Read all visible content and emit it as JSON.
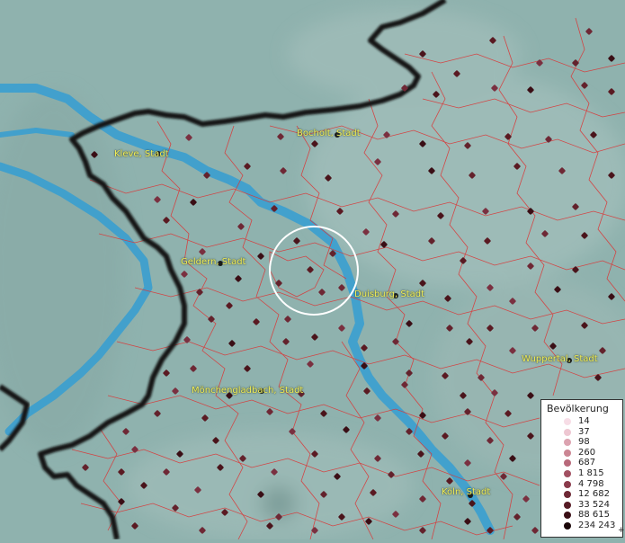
{
  "map": {
    "legend_title": "Bevölkerung",
    "legend_items": [
      {
        "label": "14",
        "color": "#f7dde6"
      },
      {
        "label": "37",
        "color": "#eec7d2"
      },
      {
        "label": "98",
        "color": "#dca3b0"
      },
      {
        "label": "260",
        "color": "#cb8693"
      },
      {
        "label": "687",
        "color": "#b8697a"
      },
      {
        "label": "1 815",
        "color": "#a25061"
      },
      {
        "label": "4 798",
        "color": "#8a3a4b"
      },
      {
        "label": "12 682",
        "color": "#6e2835"
      },
      {
        "label": "33 524",
        "color": "#561a24"
      },
      {
        "label": "88 615",
        "color": "#3a0e15"
      },
      {
        "label": "234 243",
        "color": "#1a0608"
      }
    ],
    "legend_plus": "+",
    "cities": {
      "bocholt": "Bocholt, Stadt",
      "kleve": "Kleve, Stadt",
      "geldern": "Geldern, Stadt",
      "duisburg": "Duisburg, Stadt",
      "wuppertal": "Wuppertal, Stadt",
      "moenchengladbach": "Mönchengladbach, Stadt",
      "koeln": "Köln, Stadt"
    },
    "colors": {
      "background": "#8fb2ae",
      "river": "#3a9fd0",
      "district_border": "#d83a3a",
      "national_border": "#141414",
      "city_label": "#f2f05a",
      "marker": "#5a1a22"
    }
  }
}
